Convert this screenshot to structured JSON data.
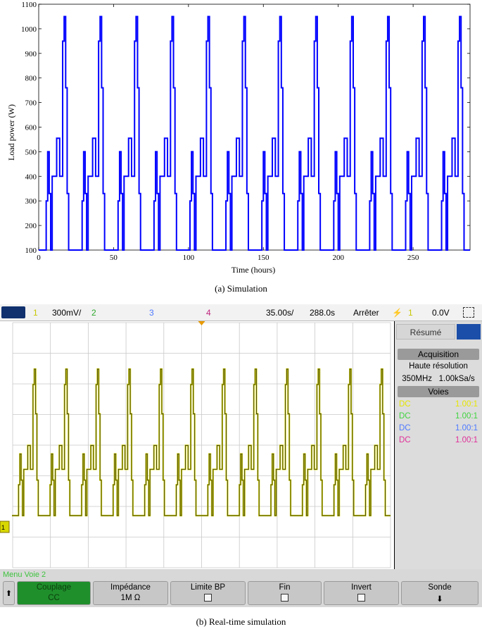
{
  "figure_a": {
    "caption": "(a) Simulation"
  },
  "figure_b": {
    "caption": "(b) Real-time simulation",
    "top_bar": {
      "ch1_num": "1",
      "ch1_scale": "300mV/",
      "ch2_num": "2",
      "ch3_num": "3",
      "ch4_num": "4",
      "time_div": "35.00s/",
      "time_pos": "288.0s",
      "run_state": "Arrêter",
      "trig_src": "1",
      "trig_level": "0.0V"
    },
    "side_panel": {
      "tab_summary": "Résumé",
      "acq_header": "Acquisition",
      "acq_mode": "Haute résolution",
      "bandwidth": "350MHz",
      "sample_rate": "1.00kSa/s",
      "channels_header": "Voies",
      "channels": [
        {
          "coupling": "DC",
          "probe": "1.00:1",
          "color": "#e6e600"
        },
        {
          "coupling": "DC",
          "probe": "1.00:1",
          "color": "#3fd43f"
        },
        {
          "coupling": "DC",
          "probe": "1.00:1",
          "color": "#4d79ff"
        },
        {
          "coupling": "DC",
          "probe": "1.00:1",
          "color": "#e0309a"
        }
      ]
    },
    "menu": {
      "title": "Menu Voie 2",
      "softkeys": [
        {
          "label": "Couplage",
          "value": "CC"
        },
        {
          "label": "Impédance",
          "value": "1M Ω"
        },
        {
          "label": "Limite BP",
          "value": ""
        },
        {
          "label": "Fin",
          "value": ""
        },
        {
          "label": "Invert",
          "value": ""
        },
        {
          "label": "Sonde",
          "value": ""
        }
      ]
    },
    "trace_color": "#d8d800",
    "colors": {
      "ch1": "#e6e600",
      "ch2": "#3fd43f",
      "ch3": "#4d79ff",
      "ch4": "#e0309a"
    }
  },
  "chart_data": {
    "type": "line",
    "title": "",
    "xlabel": "Time (hours)",
    "ylabel": "Load power (W)",
    "xlim": [
      0,
      288
    ],
    "ylim": [
      100,
      1100
    ],
    "xticks": [
      0,
      50,
      100,
      150,
      200,
      250
    ],
    "yticks": [
      100,
      200,
      300,
      400,
      500,
      600,
      700,
      800,
      900,
      1000,
      1100
    ],
    "line_color": "#0000ff",
    "grid": false,
    "series": [
      {
        "name": "",
        "daily_profile": {
          "period_hours": 24,
          "days": 12,
          "hours": [
            0,
            5,
            6,
            7,
            8,
            9,
            12,
            14,
            16,
            17,
            18,
            19,
            20,
            21,
            22,
            23
          ],
          "watts": [
            100,
            300,
            500,
            330,
            100,
            400,
            555,
            400,
            950,
            1050,
            760,
            330,
            100,
            100,
            100,
            100
          ]
        }
      }
    ]
  }
}
